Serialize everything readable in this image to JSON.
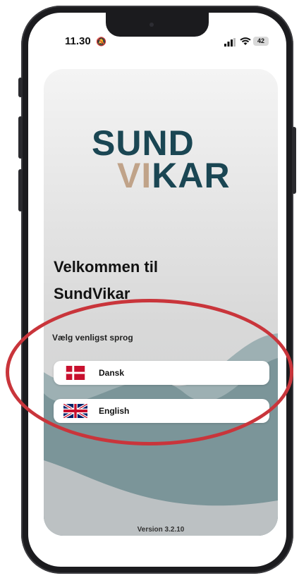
{
  "status_bar": {
    "time": "11.30",
    "battery": "42"
  },
  "logo": {
    "line1": "SUND",
    "line2_accent": "VI",
    "line2_rest": "KAR"
  },
  "welcome": {
    "line1": "Velkommen til",
    "line2": "SundVikar"
  },
  "language_prompt": "Vælg venligst sprog",
  "languages": [
    {
      "label": "Dansk",
      "flag": "denmark-flag"
    },
    {
      "label": "English",
      "flag": "uk-flag"
    }
  ],
  "version": "Version 3.2.10",
  "colors": {
    "brand_teal": "#1a4653",
    "brand_sand": "#c0a389",
    "wave": "#7b9599",
    "annotation_red": "#c9353b"
  }
}
